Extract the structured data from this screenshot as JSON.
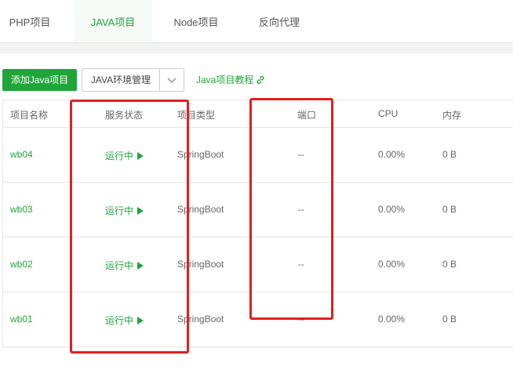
{
  "tabs": [
    {
      "label": "PHP项目",
      "active": false
    },
    {
      "label": "JAVA项目",
      "active": true
    },
    {
      "label": "Node项目",
      "active": false
    },
    {
      "label": "反向代理",
      "active": false
    }
  ],
  "toolbar": {
    "add_label": "添加Java项目",
    "env_label": "JAVA环境管理",
    "tutorial_label": "Java项目教程"
  },
  "table": {
    "headers": {
      "name": "项目名称",
      "status": "服务状态",
      "type": "项目类型",
      "port": "端口",
      "cpu": "CPU",
      "mem": "内存"
    },
    "rows": [
      {
        "name": "wb04",
        "status": "运行中",
        "type": "SpringBoot",
        "port": "--",
        "cpu": "0.00%",
        "mem": "0 B"
      },
      {
        "name": "wb03",
        "status": "运行中",
        "type": "SpringBoot",
        "port": "--",
        "cpu": "0.00%",
        "mem": "0 B"
      },
      {
        "name": "wb02",
        "status": "运行中",
        "type": "SpringBoot",
        "port": "--",
        "cpu": "0.00%",
        "mem": "0 B"
      },
      {
        "name": "wb01",
        "status": "运行中",
        "type": "SpringBoot",
        "port": "--",
        "cpu": "0.00%",
        "mem": "0 B"
      }
    ]
  },
  "colors": {
    "accent": "#20a53a",
    "highlight": "#e02020"
  },
  "icons": {
    "dropdown": "chevron-down-icon",
    "tutorial": "link-icon",
    "status": "play-icon"
  }
}
